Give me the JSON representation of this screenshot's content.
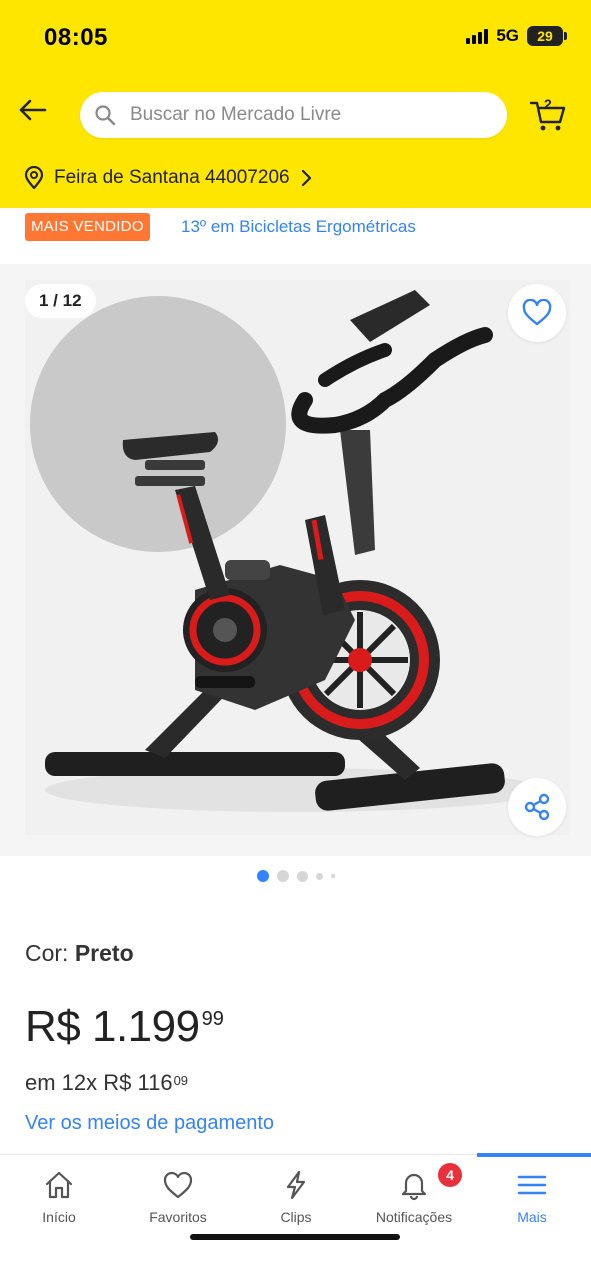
{
  "status_bar": {
    "time": "08:05",
    "network": "5G",
    "battery": "29"
  },
  "header": {
    "search_placeholder": "Buscar no Mercado Livre",
    "cart_count": "2",
    "location": "Feira de Santana 44007206",
    "brand_color": "#FFE600"
  },
  "badges": {
    "best_seller": "MAIS VENDIDO",
    "ranking": "13º em Bicicletas Ergométricas"
  },
  "gallery": {
    "counter": "1 / 12",
    "current_image": 1,
    "total_images": 12
  },
  "product": {
    "color_label": "Cor: ",
    "color_value": "Preto",
    "price_main": "R$ 1.199",
    "price_cents": "99",
    "installments_prefix": "em 12x R$ 116",
    "installments_cents": "09",
    "payment_link": "Ver os meios de pagamento"
  },
  "tabbar": {
    "tabs": [
      {
        "label": "Início",
        "icon": "home-icon"
      },
      {
        "label": "Favoritos",
        "icon": "heart-icon"
      },
      {
        "label": "Clips",
        "icon": "lightning-icon"
      },
      {
        "label": "Notificações",
        "icon": "bell-icon"
      },
      {
        "label": "Mais",
        "icon": "menu-icon"
      }
    ],
    "notification_count": "4",
    "active_tab": "Mais",
    "accent_color": "#3483FA"
  }
}
